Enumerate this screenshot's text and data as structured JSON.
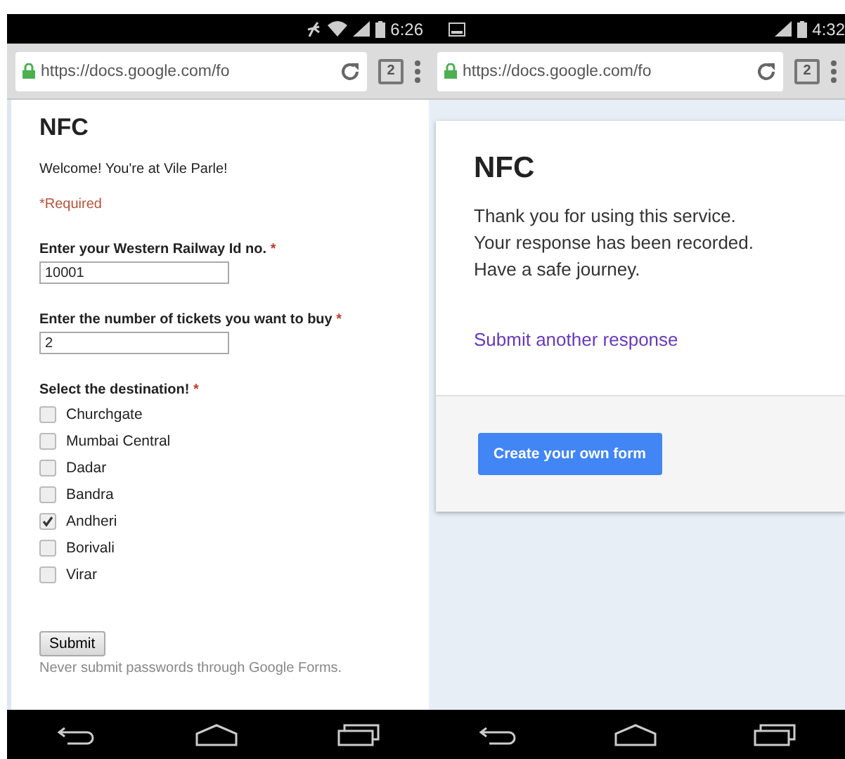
{
  "phones": [
    {
      "status_bar": {
        "time": "6:26",
        "notification_icon": false
      },
      "browser": {
        "url": "https://docs.google.com/fo",
        "tab_count": "2"
      },
      "page": {
        "kind": "form",
        "title": "NFC",
        "description": "Welcome! You're at Vile Parle!",
        "required_note": "*Required",
        "questions": [
          {
            "kind": "text",
            "label": "Enter your Western Railway Id no.",
            "required_mark": "*",
            "value": "10001"
          },
          {
            "kind": "text",
            "label": "Enter the number of tickets you want to buy",
            "required_mark": "*",
            "value": "2"
          },
          {
            "kind": "checkboxes",
            "label": "Select the destination!",
            "required_mark": "*",
            "options": [
              {
                "label": "Churchgate",
                "checked": false
              },
              {
                "label": "Mumbai Central",
                "checked": false
              },
              {
                "label": "Dadar",
                "checked": false
              },
              {
                "label": "Bandra",
                "checked": false
              },
              {
                "label": "Andheri",
                "checked": true
              },
              {
                "label": "Borivali",
                "checked": false
              },
              {
                "label": "Virar",
                "checked": false
              }
            ]
          }
        ],
        "submit": "Submit",
        "footer": "Never submit passwords through Google Forms."
      }
    },
    {
      "status_bar": {
        "time": "4:32",
        "notification_icon": true
      },
      "browser": {
        "url": "https://docs.google.com/fo",
        "tab_count": "2"
      },
      "page": {
        "kind": "confirmation",
        "title": "NFC",
        "message": [
          "Thank you for using this service.",
          "Your response has been recorded.",
          "Have a safe journey."
        ],
        "link": "Submit another response",
        "button": "Create your own form"
      }
    }
  ]
}
